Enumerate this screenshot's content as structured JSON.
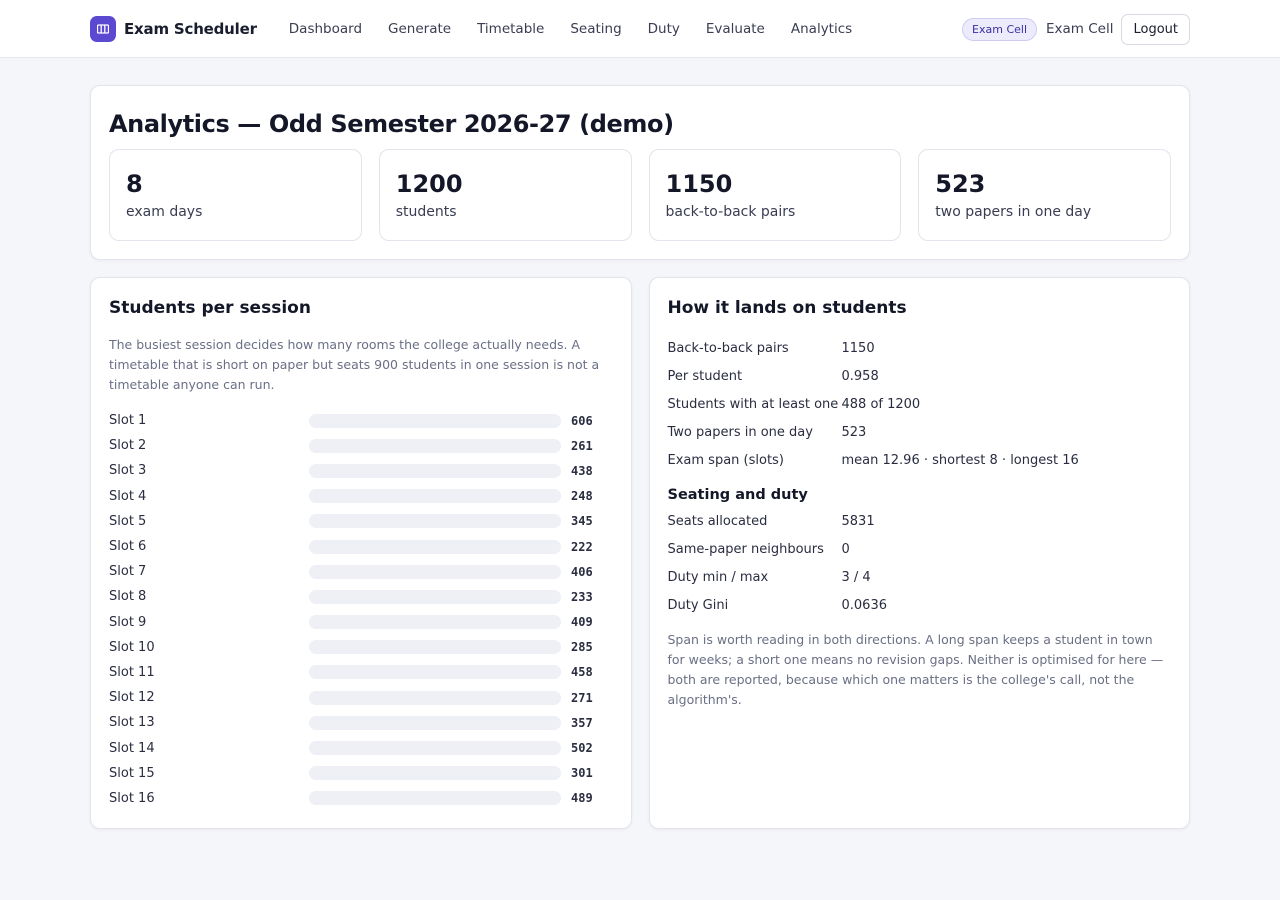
{
  "app": {
    "name": "Exam Scheduler",
    "logo_icon": "book-icon",
    "accent": "#5b49d1"
  },
  "nav": {
    "items": [
      {
        "label": "Dashboard"
      },
      {
        "label": "Generate"
      },
      {
        "label": "Timetable"
      },
      {
        "label": "Seating"
      },
      {
        "label": "Duty"
      },
      {
        "label": "Evaluate"
      },
      {
        "label": "Analytics"
      }
    ],
    "role_badge": "Exam Cell",
    "user_name": "Exam Cell",
    "logout_label": "Logout"
  },
  "summary": {
    "title": "Analytics — Odd Semester 2026-27 (demo)",
    "stats": [
      {
        "value": "8",
        "label": "exam days"
      },
      {
        "value": "1200",
        "label": "students"
      },
      {
        "value": "1150",
        "label": "back-to-back pairs"
      },
      {
        "value": "523",
        "label": "two papers in one day"
      }
    ]
  },
  "sessions": {
    "title": "Students per session",
    "description": "The busiest session decides how many rooms the college actually needs. A timetable that is short on paper but seats 900 students in one session is not a timetable anyone can run.",
    "slots": [
      {
        "label": "Slot 1",
        "value": 606
      },
      {
        "label": "Slot 2",
        "value": 261
      },
      {
        "label": "Slot 3",
        "value": 438
      },
      {
        "label": "Slot 4",
        "value": 248
      },
      {
        "label": "Slot 5",
        "value": 345
      },
      {
        "label": "Slot 6",
        "value": 222
      },
      {
        "label": "Slot 7",
        "value": 406
      },
      {
        "label": "Slot 8",
        "value": 233
      },
      {
        "label": "Slot 9",
        "value": 409
      },
      {
        "label": "Slot 10",
        "value": 285
      },
      {
        "label": "Slot 11",
        "value": 458
      },
      {
        "label": "Slot 12",
        "value": 271
      },
      {
        "label": "Slot 13",
        "value": 357
      },
      {
        "label": "Slot 14",
        "value": 502
      },
      {
        "label": "Slot 15",
        "value": 301
      },
      {
        "label": "Slot 16",
        "value": 489
      }
    ]
  },
  "impact": {
    "title": "How it lands on students",
    "rows": [
      {
        "key": "Back-to-back pairs",
        "value": "1150"
      },
      {
        "key": "Per student",
        "value": "0.958"
      },
      {
        "key": "Students with at least one",
        "value": "488 of 1200"
      },
      {
        "key": "Two papers in one day",
        "value": "523"
      },
      {
        "key": "Exam span (slots)",
        "value": "mean 12.96 · shortest 8 · longest 16"
      }
    ],
    "seating_title": "Seating and duty",
    "seating_rows": [
      {
        "key": "Seats allocated",
        "value": "5831"
      },
      {
        "key": "Same-paper neighbours",
        "value": "0"
      },
      {
        "key": "Duty min / max",
        "value": "3 / 4"
      },
      {
        "key": "Duty Gini",
        "value": "0.0636"
      }
    ],
    "note": "Span is worth reading in both directions. A long span keeps a student in town for weeks; a short one means no revision gaps. Neither is optimised for here — both are reported, because which one matters is the college's call, not the algorithm's."
  }
}
